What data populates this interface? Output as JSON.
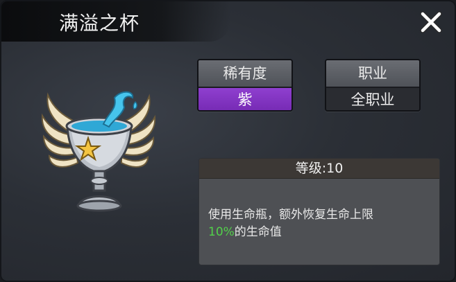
{
  "window": {
    "title": "满溢之杯",
    "close_icon": "close-icon"
  },
  "item": {
    "icon": "winged-chalice-icon",
    "colors": {
      "rarity_purple": "#8a3cc9",
      "highlight_green": "#52d14a",
      "liquid_blue": "#38b8e0"
    }
  },
  "rarity": {
    "label": "稀有度",
    "value": "紫"
  },
  "job": {
    "label": "职业",
    "value": "全职业"
  },
  "level": {
    "label": "等级:10"
  },
  "description": {
    "line1": "使用生命瓶，额外恢复生命上限",
    "highlight": "10%",
    "line2_rest": "的生命值"
  }
}
